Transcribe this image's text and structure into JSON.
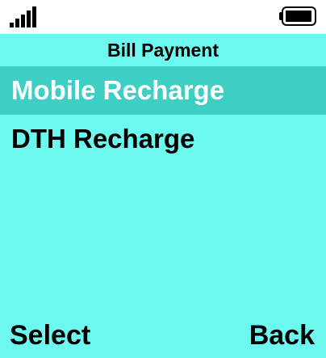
{
  "status_bar": {
    "signal_icon": "signal-strength-icon",
    "battery_icon": "battery-full-icon",
    "battery_level": 1.0
  },
  "header": {
    "title": "Bill Payment"
  },
  "menu": {
    "items": [
      {
        "label": "Mobile Recharge",
        "selected": true
      },
      {
        "label": "DTH Recharge",
        "selected": false
      }
    ]
  },
  "softkeys": {
    "left_label": "Select",
    "right_label": "Back"
  },
  "colors": {
    "background": "#6cf7ef",
    "selection": "#3ecfc4",
    "status_bar": "#ffffff"
  }
}
